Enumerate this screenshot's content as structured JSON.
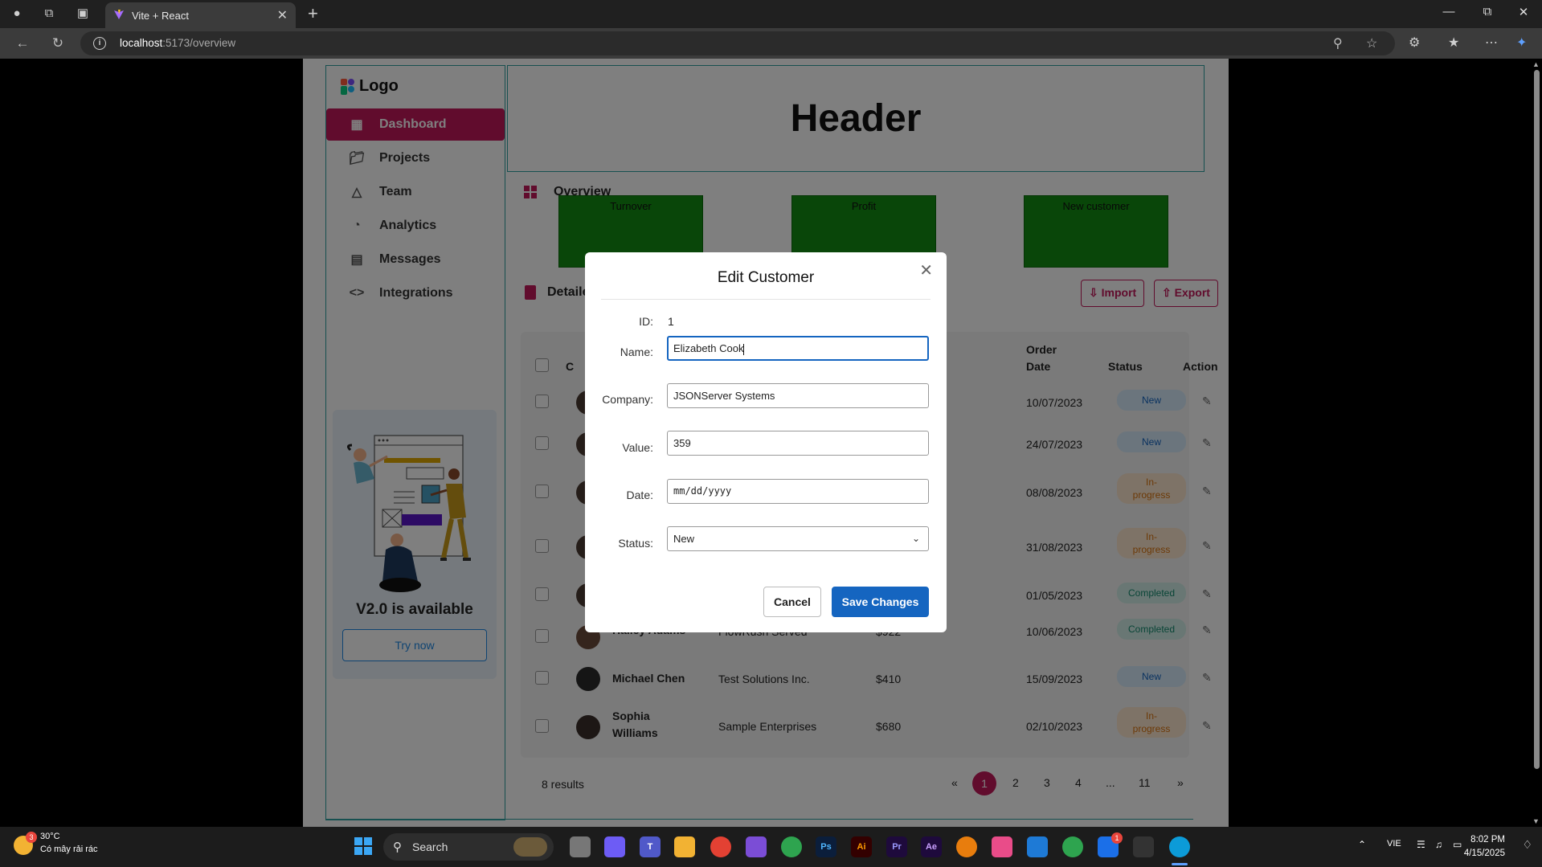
{
  "browser": {
    "tab_title": "Vite + React",
    "url_host": "localhost",
    "url_path": ":5173/overview"
  },
  "app": {
    "logo": "Logo",
    "header": "Header",
    "nav": [
      {
        "label": "Dashboard",
        "icon": "grid-icon",
        "active": true
      },
      {
        "label": "Projects",
        "icon": "folder-icon",
        "active": false
      },
      {
        "label": "Team",
        "icon": "team-icon",
        "active": false
      },
      {
        "label": "Analytics",
        "icon": "pie-chart-icon",
        "active": false
      },
      {
        "label": "Messages",
        "icon": "chat-icon",
        "active": false
      },
      {
        "label": "Integrations",
        "icon": "code-icon",
        "active": false
      }
    ],
    "promo": {
      "title": "V2.0 is available",
      "button": "Try now"
    },
    "overview_title": "Overview",
    "stats": [
      "Turnover",
      "Profit",
      "New customer"
    ],
    "details_title": "Detailed report",
    "import_label": "Import",
    "export_label": "Export",
    "columns": {
      "order_date": "Order\nDate",
      "status": "Status",
      "action": "Action"
    },
    "rows": [
      {
        "name": "",
        "company": "",
        "value": "",
        "date": "10/07/2023",
        "status": "New",
        "kind": "new"
      },
      {
        "name": "",
        "company": "",
        "value": "",
        "date": "24/07/2023",
        "status": "New",
        "kind": "new"
      },
      {
        "name": "",
        "company": "",
        "value": "",
        "date": "08/08/2023",
        "status": "In-\nprogress",
        "kind": "prog"
      },
      {
        "name": "",
        "company": "",
        "value": "",
        "date": "31/08/2023",
        "status": "In-\nprogress",
        "kind": "prog"
      },
      {
        "name": "",
        "company": "",
        "value": "",
        "date": "01/05/2023",
        "status": "Completed",
        "kind": "done"
      },
      {
        "name": "Hailey Adams",
        "company": "FlowRush Served",
        "value": "$922",
        "date": "10/06/2023",
        "status": "Completed",
        "kind": "done"
      },
      {
        "name": "Michael Chen",
        "company": "Test Solutions Inc.",
        "value": "$410",
        "date": "15/09/2023",
        "status": "New",
        "kind": "new"
      },
      {
        "name": "Sophia\nWilliams",
        "company": "Sample Enterprises",
        "value": "$680",
        "date": "02/10/2023",
        "status": "In-\nprogress",
        "kind": "prog"
      }
    ],
    "results": "8 results",
    "pagination": [
      "«",
      "1",
      "2",
      "3",
      "4",
      "...",
      "11",
      "»"
    ]
  },
  "modal": {
    "title": "Edit Customer",
    "id_label": "ID:",
    "id_value": "1",
    "name_label": "Name:",
    "name_value": "Elizabeth Cook",
    "company_label": "Company:",
    "company_value": "JSONServer Systems",
    "value_label": "Value:",
    "value_value": "359",
    "date_label": "Date:",
    "date_placeholder": "mm/dd/yyyy",
    "status_label": "Status:",
    "status_value": "New",
    "cancel": "Cancel",
    "save": "Save Changes"
  },
  "taskbar": {
    "temp": "30°C",
    "weather_text": "Có mây rải rác",
    "weather_badge": "3",
    "search": "Search",
    "lang": "VIE",
    "time": "8:02 PM",
    "date": "4/15/2025",
    "zalo_badge": "1"
  }
}
